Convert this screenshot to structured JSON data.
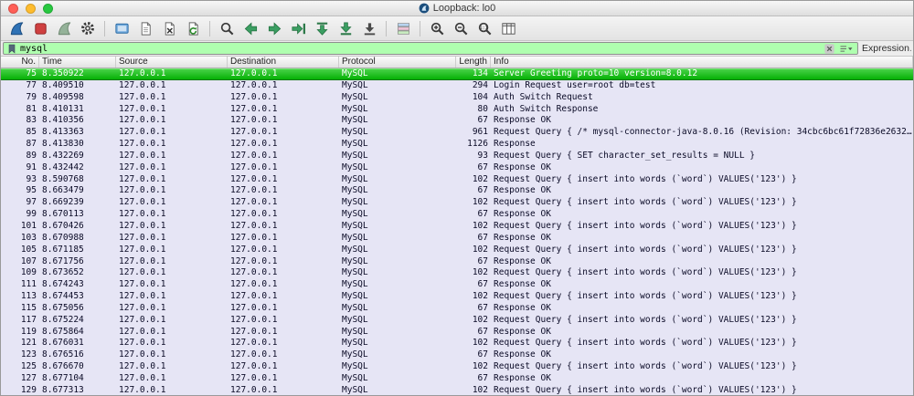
{
  "window": {
    "title": "Loopback: lo0"
  },
  "toolbar": {
    "groups": [
      [
        "start-capture",
        "stop-capture",
        "restart-capture",
        "capture-options"
      ],
      [
        "open-file",
        "save-file",
        "close-file",
        "reload-file"
      ],
      [
        "find-packet",
        "go-back",
        "go-forward",
        "go-to-packet",
        "go-first-packet",
        "go-last-packet",
        "auto-scroll"
      ],
      [
        "colorize-packets"
      ],
      [
        "zoom-in",
        "zoom-out",
        "zoom-original",
        "resize-columns"
      ]
    ]
  },
  "filter": {
    "value": "mysql",
    "expression_label": "Expression…"
  },
  "colors": {
    "filter_valid_bg": "#afffaf",
    "selected_row": "#00ae00",
    "row_bg": "#e6e5f5",
    "accent_blue": "#2f72b5"
  },
  "table": {
    "columns": [
      {
        "key": "no",
        "label": "No."
      },
      {
        "key": "time",
        "label": "Time"
      },
      {
        "key": "source",
        "label": "Source"
      },
      {
        "key": "destination",
        "label": "Destination"
      },
      {
        "key": "protocol",
        "label": "Protocol"
      },
      {
        "key": "length",
        "label": "Length"
      },
      {
        "key": "info",
        "label": "Info"
      }
    ],
    "rows": [
      {
        "no": "75",
        "time": "8.350922",
        "source": "127.0.0.1",
        "destination": "127.0.0.1",
        "protocol": "MySQL",
        "length": "134",
        "info": "Server Greeting proto=10 version=8.0.12",
        "selected": true
      },
      {
        "no": "77",
        "time": "8.409510",
        "source": "127.0.0.1",
        "destination": "127.0.0.1",
        "protocol": "MySQL",
        "length": "294",
        "info": "Login Request user=root db=test",
        "selected": false
      },
      {
        "no": "79",
        "time": "8.409598",
        "source": "127.0.0.1",
        "destination": "127.0.0.1",
        "protocol": "MySQL",
        "length": "104",
        "info": "Auth Switch Request",
        "selected": false
      },
      {
        "no": "81",
        "time": "8.410131",
        "source": "127.0.0.1",
        "destination": "127.0.0.1",
        "protocol": "MySQL",
        "length": "80",
        "info": "Auth Switch Response",
        "selected": false
      },
      {
        "no": "83",
        "time": "8.410356",
        "source": "127.0.0.1",
        "destination": "127.0.0.1",
        "protocol": "MySQL",
        "length": "67",
        "info": "Response OK",
        "selected": false
      },
      {
        "no": "85",
        "time": "8.413363",
        "source": "127.0.0.1",
        "destination": "127.0.0.1",
        "protocol": "MySQL",
        "length": "961",
        "info": "Request Query { /* mysql-connector-java-8.0.16 (Revision: 34cbc6bc61f72836e2632…",
        "selected": false
      },
      {
        "no": "87",
        "time": "8.413830",
        "source": "127.0.0.1",
        "destination": "127.0.0.1",
        "protocol": "MySQL",
        "length": "1126",
        "info": "Response",
        "selected": false
      },
      {
        "no": "89",
        "time": "8.432269",
        "source": "127.0.0.1",
        "destination": "127.0.0.1",
        "protocol": "MySQL",
        "length": "93",
        "info": "Request Query { SET character_set_results = NULL }",
        "selected": false
      },
      {
        "no": "91",
        "time": "8.432442",
        "source": "127.0.0.1",
        "destination": "127.0.0.1",
        "protocol": "MySQL",
        "length": "67",
        "info": "Response OK",
        "selected": false
      },
      {
        "no": "93",
        "time": "8.590768",
        "source": "127.0.0.1",
        "destination": "127.0.0.1",
        "protocol": "MySQL",
        "length": "102",
        "info": "Request Query { insert into words (`word`) VALUES('123') }",
        "selected": false
      },
      {
        "no": "95",
        "time": "8.663479",
        "source": "127.0.0.1",
        "destination": "127.0.0.1",
        "protocol": "MySQL",
        "length": "67",
        "info": "Response OK",
        "selected": false
      },
      {
        "no": "97",
        "time": "8.669239",
        "source": "127.0.0.1",
        "destination": "127.0.0.1",
        "protocol": "MySQL",
        "length": "102",
        "info": "Request Query { insert into words (`word`) VALUES('123') }",
        "selected": false
      },
      {
        "no": "99",
        "time": "8.670113",
        "source": "127.0.0.1",
        "destination": "127.0.0.1",
        "protocol": "MySQL",
        "length": "67",
        "info": "Response OK",
        "selected": false
      },
      {
        "no": "101",
        "time": "8.670426",
        "source": "127.0.0.1",
        "destination": "127.0.0.1",
        "protocol": "MySQL",
        "length": "102",
        "info": "Request Query { insert into words (`word`) VALUES('123') }",
        "selected": false
      },
      {
        "no": "103",
        "time": "8.670988",
        "source": "127.0.0.1",
        "destination": "127.0.0.1",
        "protocol": "MySQL",
        "length": "67",
        "info": "Response OK",
        "selected": false
      },
      {
        "no": "105",
        "time": "8.671185",
        "source": "127.0.0.1",
        "destination": "127.0.0.1",
        "protocol": "MySQL",
        "length": "102",
        "info": "Request Query { insert into words (`word`) VALUES('123') }",
        "selected": false
      },
      {
        "no": "107",
        "time": "8.671756",
        "source": "127.0.0.1",
        "destination": "127.0.0.1",
        "protocol": "MySQL",
        "length": "67",
        "info": "Response OK",
        "selected": false
      },
      {
        "no": "109",
        "time": "8.673652",
        "source": "127.0.0.1",
        "destination": "127.0.0.1",
        "protocol": "MySQL",
        "length": "102",
        "info": "Request Query { insert into words (`word`) VALUES('123') }",
        "selected": false
      },
      {
        "no": "111",
        "time": "8.674243",
        "source": "127.0.0.1",
        "destination": "127.0.0.1",
        "protocol": "MySQL",
        "length": "67",
        "info": "Response OK",
        "selected": false
      },
      {
        "no": "113",
        "time": "8.674453",
        "source": "127.0.0.1",
        "destination": "127.0.0.1",
        "protocol": "MySQL",
        "length": "102",
        "info": "Request Query { insert into words (`word`) VALUES('123') }",
        "selected": false
      },
      {
        "no": "115",
        "time": "8.675056",
        "source": "127.0.0.1",
        "destination": "127.0.0.1",
        "protocol": "MySQL",
        "length": "67",
        "info": "Response OK",
        "selected": false
      },
      {
        "no": "117",
        "time": "8.675224",
        "source": "127.0.0.1",
        "destination": "127.0.0.1",
        "protocol": "MySQL",
        "length": "102",
        "info": "Request Query { insert into words (`word`) VALUES('123') }",
        "selected": false
      },
      {
        "no": "119",
        "time": "8.675864",
        "source": "127.0.0.1",
        "destination": "127.0.0.1",
        "protocol": "MySQL",
        "length": "67",
        "info": "Response OK",
        "selected": false
      },
      {
        "no": "121",
        "time": "8.676031",
        "source": "127.0.0.1",
        "destination": "127.0.0.1",
        "protocol": "MySQL",
        "length": "102",
        "info": "Request Query { insert into words (`word`) VALUES('123') }",
        "selected": false
      },
      {
        "no": "123",
        "time": "8.676516",
        "source": "127.0.0.1",
        "destination": "127.0.0.1",
        "protocol": "MySQL",
        "length": "67",
        "info": "Response OK",
        "selected": false
      },
      {
        "no": "125",
        "time": "8.676670",
        "source": "127.0.0.1",
        "destination": "127.0.0.1",
        "protocol": "MySQL",
        "length": "102",
        "info": "Request Query { insert into words (`word`) VALUES('123') }",
        "selected": false
      },
      {
        "no": "127",
        "time": "8.677104",
        "source": "127.0.0.1",
        "destination": "127.0.0.1",
        "protocol": "MySQL",
        "length": "67",
        "info": "Response OK",
        "selected": false
      },
      {
        "no": "129",
        "time": "8.677313",
        "source": "127.0.0.1",
        "destination": "127.0.0.1",
        "protocol": "MySQL",
        "length": "102",
        "info": "Request Query { insert into words (`word`) VALUES('123') }",
        "selected": false
      }
    ]
  }
}
